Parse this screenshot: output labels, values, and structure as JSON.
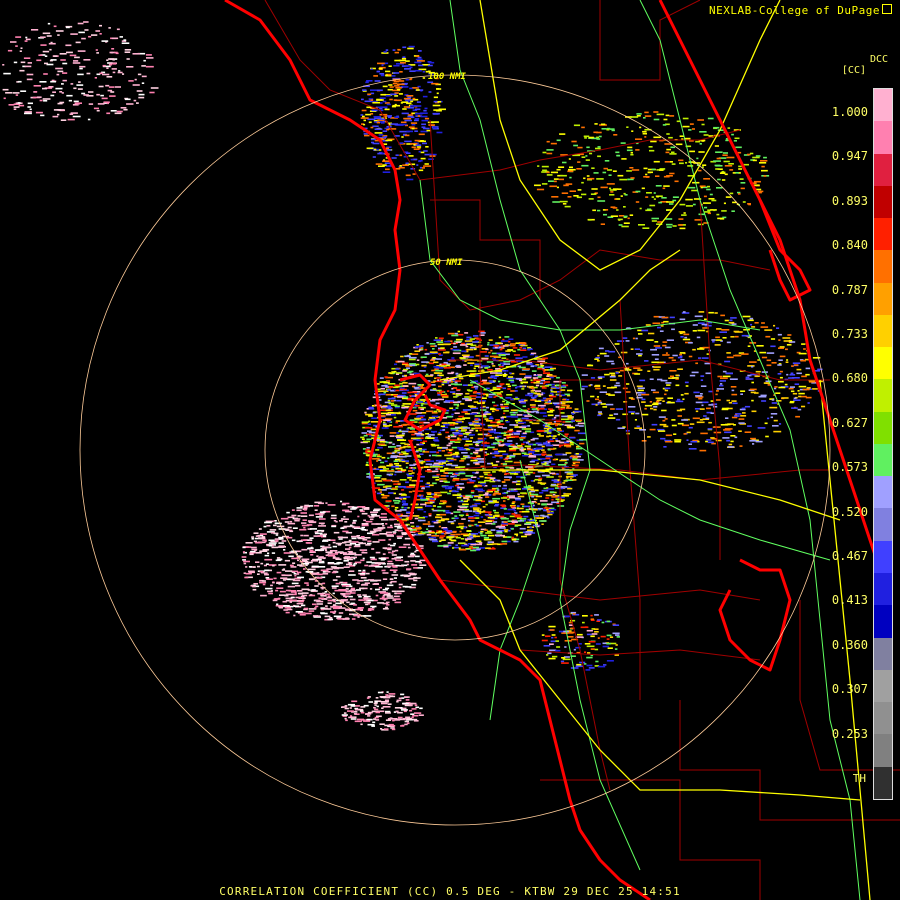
{
  "header": {
    "credit": "NEXLAB-College of DuPage"
  },
  "footer": {
    "product_line": "CORRELATION COEFFICIENT (CC) 0.5 DEG - KTBW 29 DEC 25 14:51"
  },
  "legend": {
    "title": "DCC",
    "unit": "[CC]",
    "labels": [
      "1.000",
      "0.947",
      "0.893",
      "0.840",
      "0.787",
      "0.733",
      "0.680",
      "0.627",
      "0.573",
      "0.520",
      "0.467",
      "0.413",
      "0.360",
      "0.307",
      "0.253"
    ],
    "th_label": "TH",
    "colors": [
      "#ffb0d0",
      "#ff80b0",
      "#e02040",
      "#c00000",
      "#ff2000",
      "#ff7000",
      "#ffa000",
      "#ffd000",
      "#ffff00",
      "#c0f000",
      "#80e000",
      "#60f060",
      "#a0a0ff",
      "#8080e0",
      "#4040ff",
      "#2020e0",
      "#0000c0",
      "#8080a0",
      "#a0a0a0",
      "#909090",
      "#808080",
      "#303030"
    ]
  },
  "map": {
    "range_rings": [
      {
        "label": "50 NMI"
      },
      {
        "label": "100 NMI"
      }
    ],
    "colors": {
      "background": "#000000",
      "coast": "#ff0000",
      "county": "#a00000",
      "highway": "#ffff00",
      "road": "#60ff60",
      "ring": "#ffcc99"
    }
  }
}
